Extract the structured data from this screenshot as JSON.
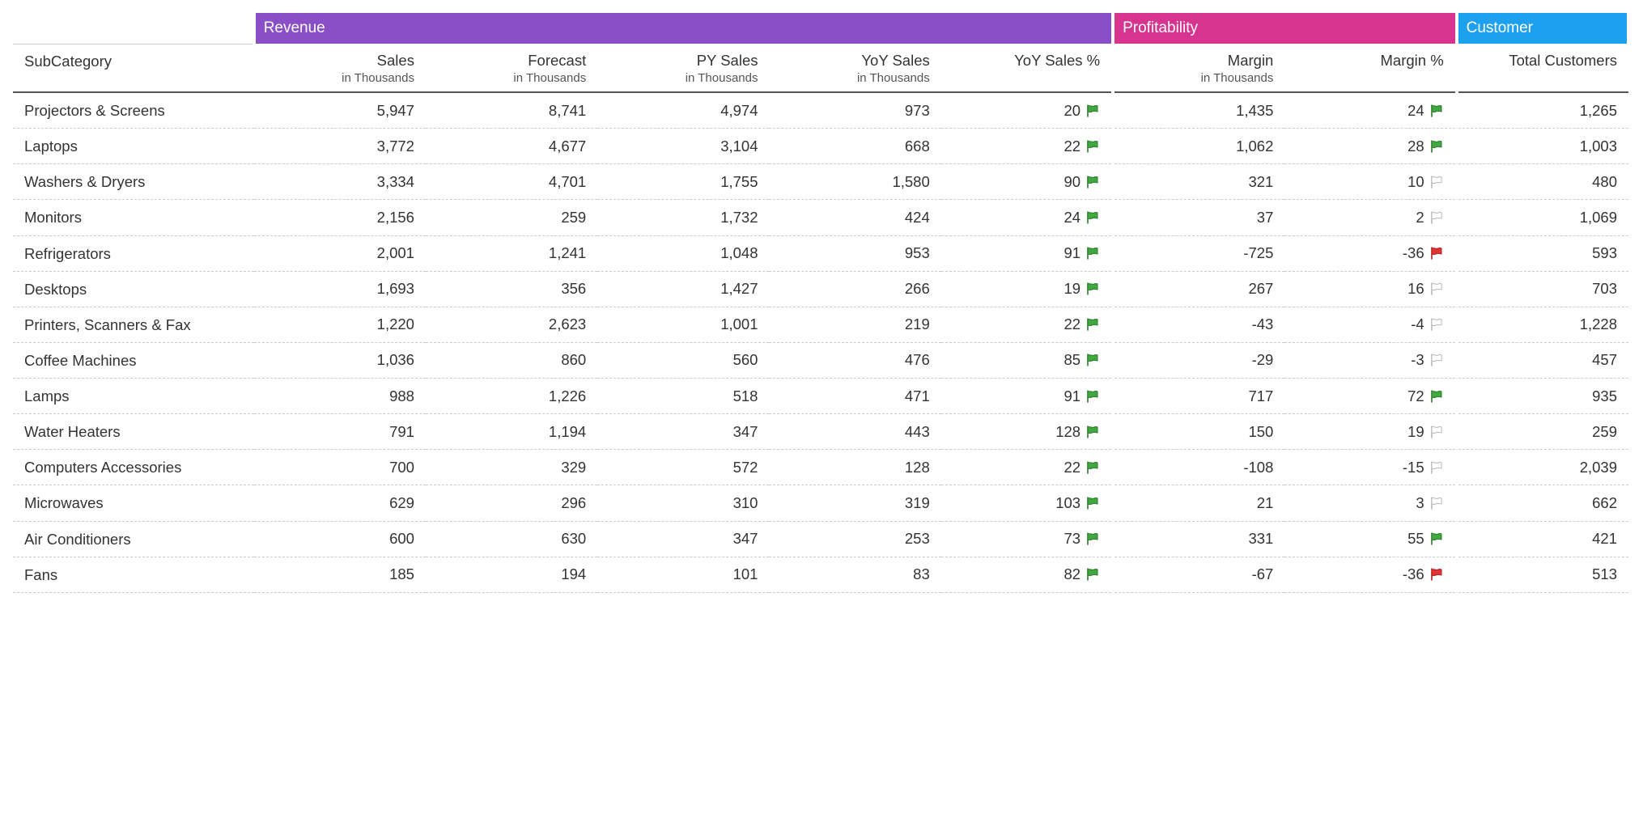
{
  "groups": [
    {
      "label": "Revenue",
      "color": "#8a4fc6",
      "span": 5
    },
    {
      "label": "Profitability",
      "color": "#d6348f",
      "span": 2
    },
    {
      "label": "Customer",
      "color": "#1da0ee",
      "span": 1
    }
  ],
  "row_header": {
    "label": "SubCategory"
  },
  "columns": [
    {
      "key": "sales",
      "label": "Sales",
      "sub": "in Thousands"
    },
    {
      "key": "forecast",
      "label": "Forecast",
      "sub": "in Thousands"
    },
    {
      "key": "py_sales",
      "label": "PY Sales",
      "sub": "in Thousands"
    },
    {
      "key": "yoy_sales",
      "label": "YoY Sales",
      "sub": "in Thousands"
    },
    {
      "key": "yoy_pct",
      "label": "YoY Sales %",
      "flag": "yoy_flag"
    },
    {
      "key": "margin",
      "label": "Margin",
      "sub": "in Thousands"
    },
    {
      "key": "margin_pct",
      "label": "Margin %",
      "flag": "margin_flag"
    },
    {
      "key": "customers",
      "label": "Total Customers"
    }
  ],
  "chart_data": {
    "type": "table",
    "title": "",
    "columns": [
      "SubCategory",
      "Sales (Thousands)",
      "Forecast (Thousands)",
      "PY Sales (Thousands)",
      "YoY Sales (Thousands)",
      "YoY Sales %",
      "Margin (Thousands)",
      "Margin %",
      "Total Customers"
    ],
    "rows": [
      {
        "name": "Projectors & Screens",
        "sales": "5,947",
        "forecast": "8,741",
        "py_sales": "4,974",
        "yoy_sales": "973",
        "yoy_pct": "20",
        "yoy_flag": "green",
        "margin": "1,435",
        "margin_pct": "24",
        "margin_flag": "green",
        "customers": "1,265"
      },
      {
        "name": "Laptops",
        "sales": "3,772",
        "forecast": "4,677",
        "py_sales": "3,104",
        "yoy_sales": "668",
        "yoy_pct": "22",
        "yoy_flag": "green",
        "margin": "1,062",
        "margin_pct": "28",
        "margin_flag": "green",
        "customers": "1,003"
      },
      {
        "name": "Washers & Dryers",
        "sales": "3,334",
        "forecast": "4,701",
        "py_sales": "1,755",
        "yoy_sales": "1,580",
        "yoy_pct": "90",
        "yoy_flag": "green",
        "margin": "321",
        "margin_pct": "10",
        "margin_flag": "outline",
        "customers": "480"
      },
      {
        "name": "Monitors",
        "sales": "2,156",
        "forecast": "259",
        "py_sales": "1,732",
        "yoy_sales": "424",
        "yoy_pct": "24",
        "yoy_flag": "green",
        "margin": "37",
        "margin_pct": "2",
        "margin_flag": "outline",
        "customers": "1,069"
      },
      {
        "name": "Refrigerators",
        "sales": "2,001",
        "forecast": "1,241",
        "py_sales": "1,048",
        "yoy_sales": "953",
        "yoy_pct": "91",
        "yoy_flag": "green",
        "margin": "-725",
        "margin_pct": "-36",
        "margin_flag": "red",
        "customers": "593"
      },
      {
        "name": "Desktops",
        "sales": "1,693",
        "forecast": "356",
        "py_sales": "1,427",
        "yoy_sales": "266",
        "yoy_pct": "19",
        "yoy_flag": "green",
        "margin": "267",
        "margin_pct": "16",
        "margin_flag": "outline",
        "customers": "703"
      },
      {
        "name": "Printers, Scanners & Fax",
        "sales": "1,220",
        "forecast": "2,623",
        "py_sales": "1,001",
        "yoy_sales": "219",
        "yoy_pct": "22",
        "yoy_flag": "green",
        "margin": "-43",
        "margin_pct": "-4",
        "margin_flag": "outline",
        "customers": "1,228"
      },
      {
        "name": "Coffee Machines",
        "sales": "1,036",
        "forecast": "860",
        "py_sales": "560",
        "yoy_sales": "476",
        "yoy_pct": "85",
        "yoy_flag": "green",
        "margin": "-29",
        "margin_pct": "-3",
        "margin_flag": "outline",
        "customers": "457"
      },
      {
        "name": "Lamps",
        "sales": "988",
        "forecast": "1,226",
        "py_sales": "518",
        "yoy_sales": "471",
        "yoy_pct": "91",
        "yoy_flag": "green",
        "margin": "717",
        "margin_pct": "72",
        "margin_flag": "green",
        "customers": "935"
      },
      {
        "name": "Water Heaters",
        "sales": "791",
        "forecast": "1,194",
        "py_sales": "347",
        "yoy_sales": "443",
        "yoy_pct": "128",
        "yoy_flag": "green",
        "margin": "150",
        "margin_pct": "19",
        "margin_flag": "outline",
        "customers": "259"
      },
      {
        "name": "Computers Accessories",
        "sales": "700",
        "forecast": "329",
        "py_sales": "572",
        "yoy_sales": "128",
        "yoy_pct": "22",
        "yoy_flag": "green",
        "margin": "-108",
        "margin_pct": "-15",
        "margin_flag": "outline",
        "customers": "2,039"
      },
      {
        "name": "Microwaves",
        "sales": "629",
        "forecast": "296",
        "py_sales": "310",
        "yoy_sales": "319",
        "yoy_pct": "103",
        "yoy_flag": "green",
        "margin": "21",
        "margin_pct": "3",
        "margin_flag": "outline",
        "customers": "662"
      },
      {
        "name": "Air Conditioners",
        "sales": "600",
        "forecast": "630",
        "py_sales": "347",
        "yoy_sales": "253",
        "yoy_pct": "73",
        "yoy_flag": "green",
        "margin": "331",
        "margin_pct": "55",
        "margin_flag": "green",
        "customers": "421"
      },
      {
        "name": "Fans",
        "sales": "185",
        "forecast": "194",
        "py_sales": "101",
        "yoy_sales": "83",
        "yoy_pct": "82",
        "yoy_flag": "green",
        "margin": "-67",
        "margin_pct": "-36",
        "margin_flag": "red",
        "customers": "513"
      }
    ]
  }
}
